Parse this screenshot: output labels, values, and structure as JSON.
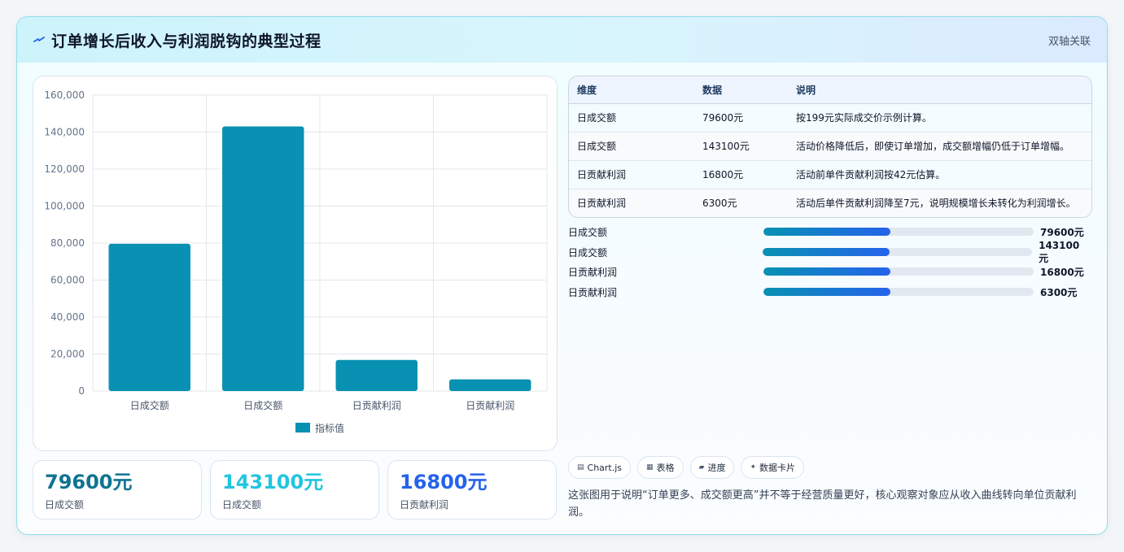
{
  "header": {
    "title": "订单增长后收入与利润脱钩的典型过程",
    "tag": "双轴关联",
    "icon": "lightning-icon"
  },
  "chart_data": {
    "type": "bar",
    "categories": [
      "日成交额",
      "日成交额",
      "日贡献利润",
      "日贡献利润"
    ],
    "series": [
      {
        "name": "指标值",
        "values": [
          79600,
          143100,
          16800,
          6300
        ],
        "color": "#0891b2"
      }
    ],
    "ylim": [
      0,
      160000
    ],
    "yticks": [
      "0",
      "20,000",
      "40,000",
      "60,000",
      "80,000",
      "100,000",
      "120,000",
      "140,000",
      "160,000"
    ],
    "grid": true,
    "legend": "bottom"
  },
  "stats": [
    {
      "value": "79600元",
      "label": "日成交额",
      "color": "#0e7490"
    },
    {
      "value": "143100元",
      "label": "日成交额",
      "color": "#22c5e0"
    },
    {
      "value": "16800元",
      "label": "日贡献利润",
      "color": "#2563eb"
    }
  ],
  "table": {
    "headers": [
      "维度",
      "数据",
      "说明"
    ],
    "rows": [
      [
        "日成交额",
        "79600元",
        "按199元实际成交价示例计算。"
      ],
      [
        "日成交额",
        "143100元",
        "活动价格降低后，即使订单增加，成交额增幅仍低于订单增幅。"
      ],
      [
        "日贡献利润",
        "16800元",
        "活动前单件贡献利润按42元估算。"
      ],
      [
        "日贡献利润",
        "6300元",
        "活动后单件贡献利润降至7元，说明规模增长未转化为利润增长。"
      ]
    ]
  },
  "progress": [
    {
      "label": "日成交额",
      "value": "79600元",
      "fill": 0.47
    },
    {
      "label": "日成交额",
      "value": "143100元",
      "fill": 0.47
    },
    {
      "label": "日贡献利润",
      "value": "16800元",
      "fill": 0.47
    },
    {
      "label": "日贡献利润",
      "value": "6300元",
      "fill": 0.47
    }
  ],
  "chips": [
    {
      "label": "Chart.js",
      "icon": "chart-icon"
    },
    {
      "label": "表格",
      "icon": "table-icon"
    },
    {
      "label": "进度",
      "icon": "progress-icon"
    },
    {
      "label": "数据卡片",
      "icon": "sparkle-icon"
    }
  ],
  "note": "这张图用于说明“订单更多、成交额更高”并不等于经营质量更好，核心观察对象应从收入曲线转向单位贡献利润。"
}
